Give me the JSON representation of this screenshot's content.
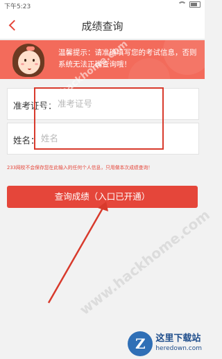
{
  "status_bar": {
    "time": "下午5:23"
  },
  "nav": {
    "title": "成绩查询"
  },
  "banner": {
    "tip": "温馨提示：请准确填写您的考试信息，否则系统无法正确查询哦！"
  },
  "form": {
    "exam_id": {
      "label": "准考证号：",
      "placeholder": "准考证号",
      "value": ""
    },
    "name": {
      "label": "姓名：",
      "placeholder": "姓名",
      "value": ""
    }
  },
  "notice": "233网校不会保存您在此输入的任何个人信息，只用做本次成绩查询！",
  "query_button": {
    "label": "查询成绩（入口已开通）"
  },
  "watermark": {
    "site": "www.hackhome.com",
    "logo_letter": "Z",
    "logo_cn": "这里下载站",
    "logo_en": "heredown.com"
  },
  "colors": {
    "accent": "#e5463a",
    "banner": "#f36b5b",
    "highlight": "#d83a2c"
  }
}
